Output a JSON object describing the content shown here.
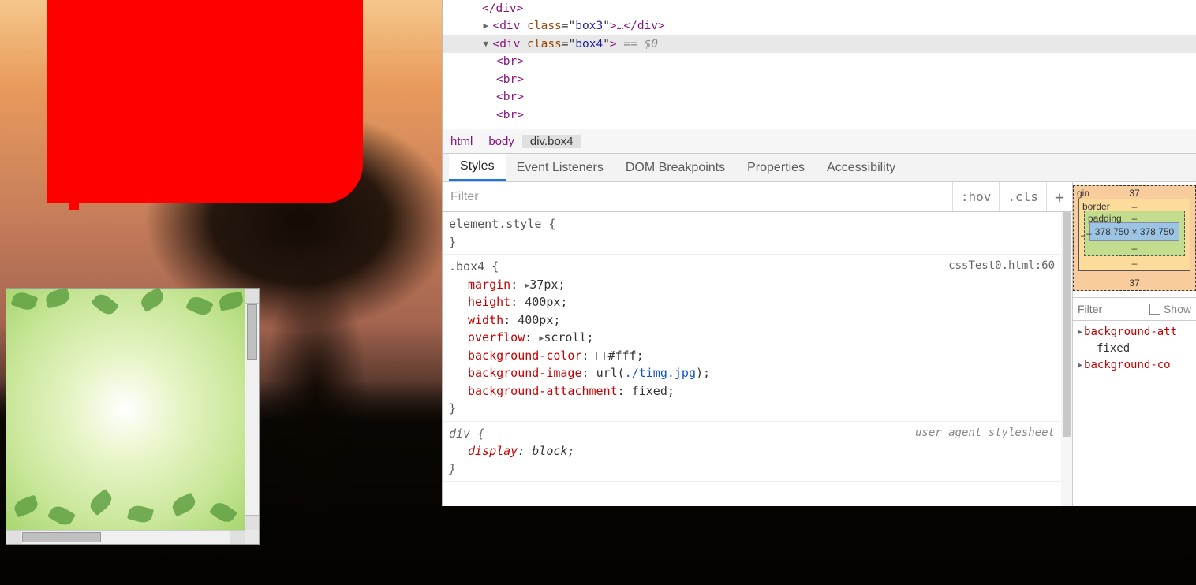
{
  "dom": {
    "line0": "</div>",
    "line1": {
      "tw": "▶",
      "open": "<",
      "tag": "div",
      "attr": "class",
      "aval": "box3",
      "mid": ">…</",
      "close": ">"
    },
    "line2": {
      "gutter": "…  ",
      "tw": "▼",
      "open": "<",
      "tag": "div",
      "attr": "class",
      "aval": "box4",
      "close": ">",
      "eq": " == $0"
    },
    "br": "<br>"
  },
  "breadcrumb": {
    "c0": "html",
    "c1": "body",
    "c2": "div.box4"
  },
  "tabs": {
    "t0": "Styles",
    "t1": "Event Listeners",
    "t2": "DOM Breakpoints",
    "t3": "Properties",
    "t4": "Accessibility"
  },
  "filter": {
    "placeholder": "Filter",
    "hov": ":hov",
    "cls": ".cls",
    "plus": "+"
  },
  "rules": {
    "elstyle_sel": "element.style ",
    "brace_open": "{",
    "brace_close": "}",
    "box4_sel": ".box4 ",
    "box4_src": "cssTest0.html:60",
    "p_margin": {
      "n": "margin",
      "v": "37px"
    },
    "p_height": {
      "n": "height",
      "v": "400px"
    },
    "p_width": {
      "n": "width",
      "v": "400px"
    },
    "p_overflow": {
      "n": "overflow",
      "v": "scroll"
    },
    "p_bgcolor": {
      "n": "background-color",
      "v": "#fff"
    },
    "p_bgimg": {
      "n": "background-image",
      "pre": "url(",
      "url": "./timg.jpg",
      "post": ")"
    },
    "p_bgatt": {
      "n": "background-attachment",
      "v": "fixed"
    },
    "div_sel": "div ",
    "div_src": "user agent stylesheet",
    "p_display": {
      "n": "display",
      "v": "block"
    }
  },
  "boxmodel": {
    "margin_label": "gin",
    "margin_top": "37",
    "margin_bottom": "37",
    "border_label": "border",
    "border_v": "–",
    "border_l": "–",
    "padding_label": "padding",
    "padding_v": "–",
    "padding_l": "–",
    "content": "378.750 × 378.750"
  },
  "computed_filter": {
    "placeholder": "Filter",
    "show": "Show"
  },
  "computed": {
    "r0": {
      "n": "background-att",
      "v": "fixed"
    },
    "r1": {
      "n": "background-co"
    }
  }
}
